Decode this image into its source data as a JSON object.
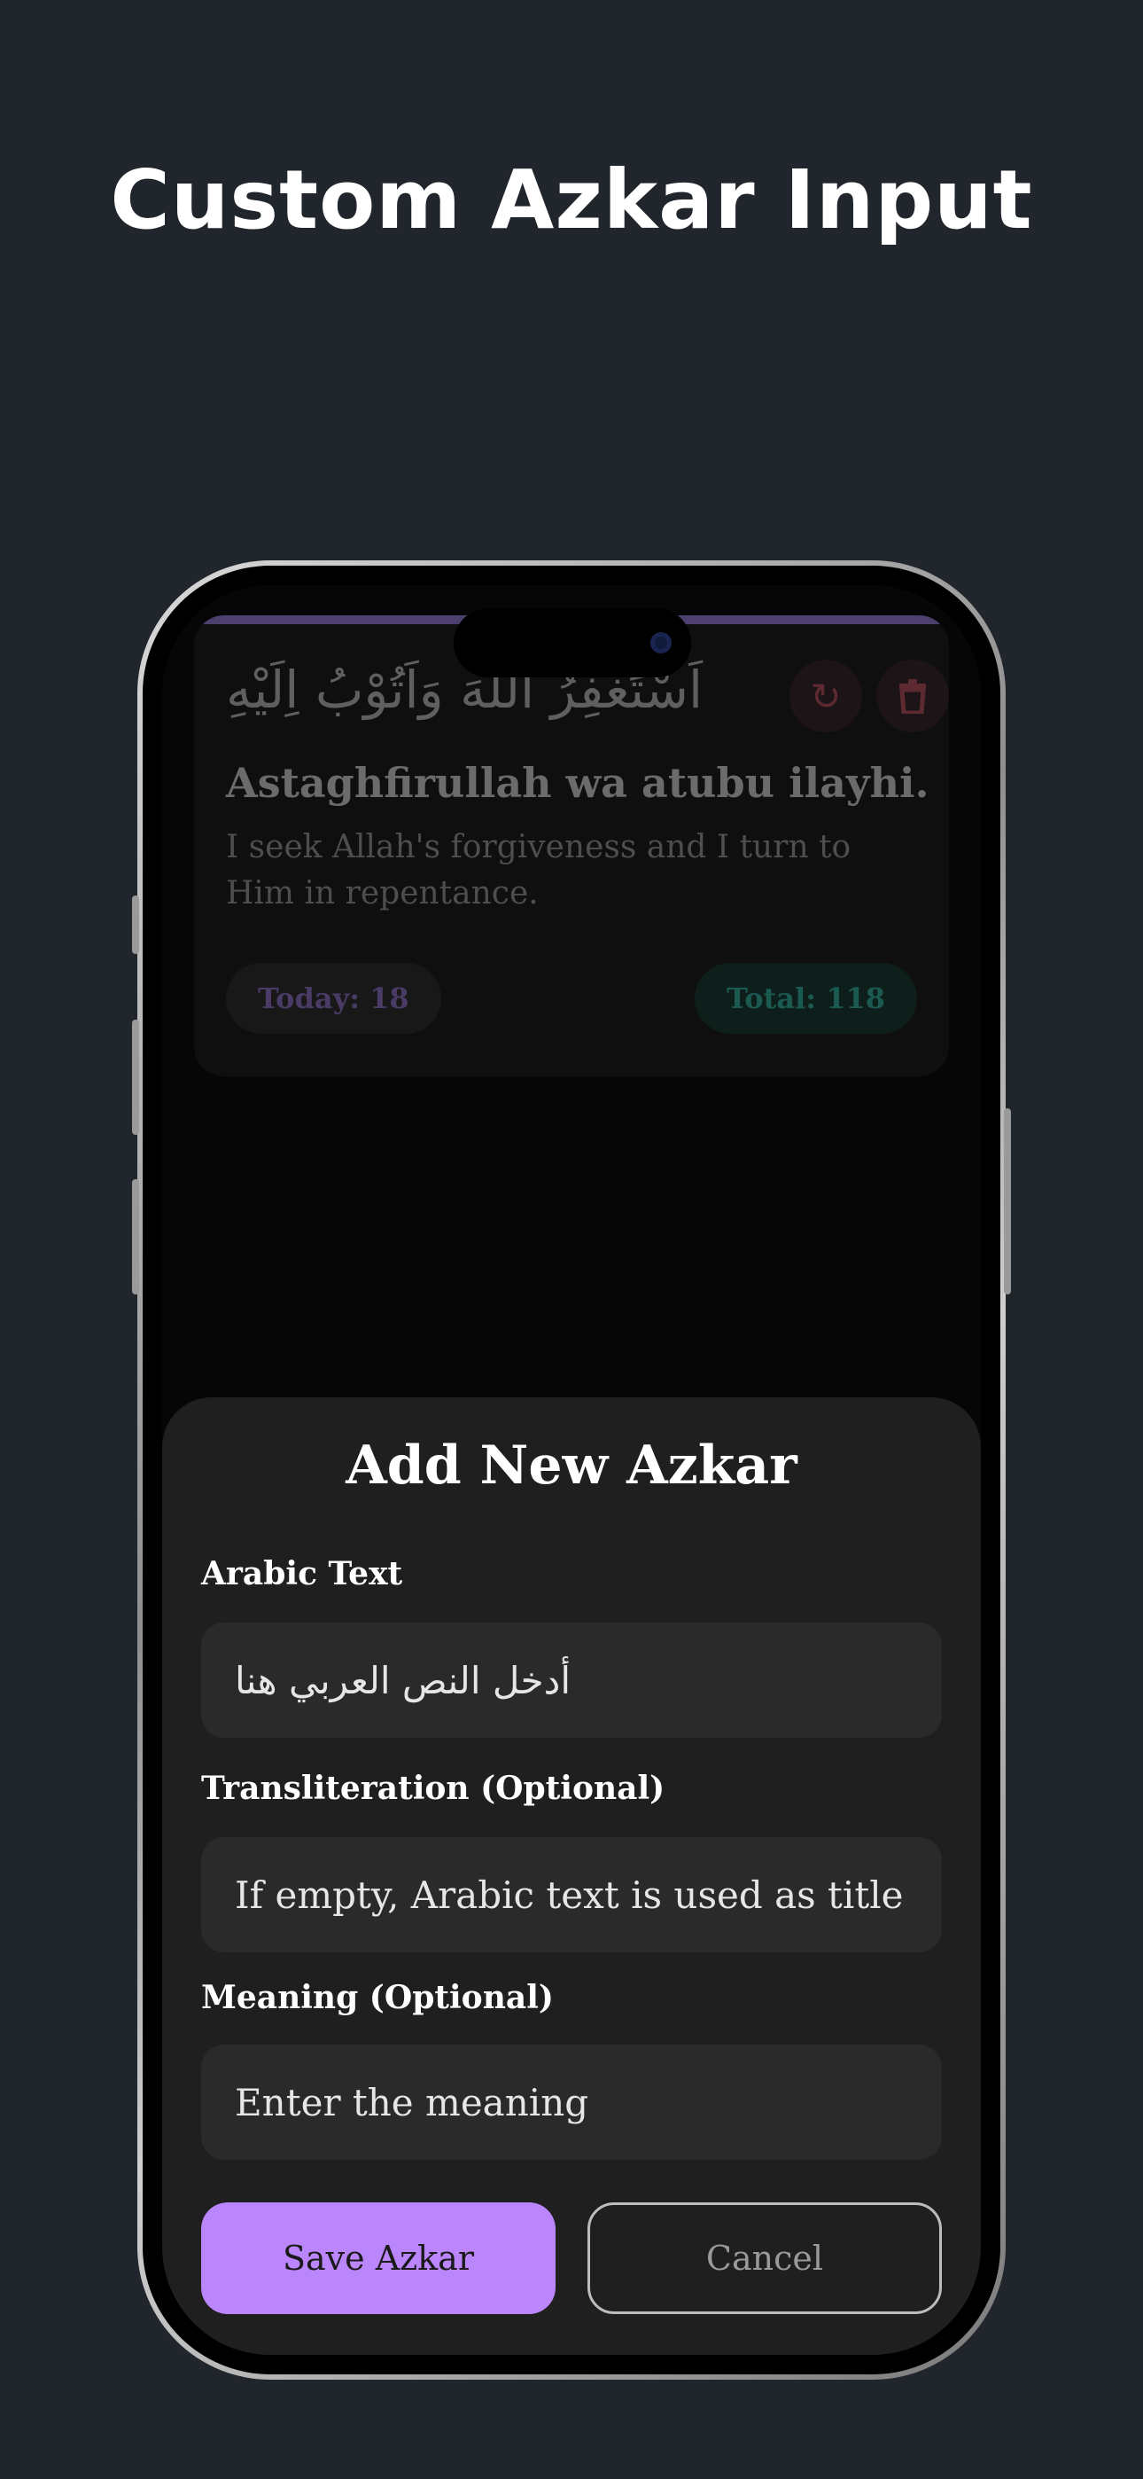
{
  "headline": "Custom Azkar Input",
  "card": {
    "arabic": "اَسْتَغْفِرُ اللّٰهَ وَاَتُوْبُ اِلَيْهِ",
    "transliteration": "Astaghfirullah wa atubu ilayhi.",
    "meaning": "I seek Allah's forgiveness and I turn to Him in repentance.",
    "today": "Today: 18",
    "total": "Total: 118",
    "reset_icon": "refresh-icon",
    "delete_icon": "trash-icon"
  },
  "sheet": {
    "title": "Add New Azkar",
    "arabic_label": "Arabic Text",
    "arabic_placeholder": "أدخل النص العربي هنا",
    "translit_label": "Transliteration (Optional)",
    "translit_placeholder": "If empty, Arabic text is used as title",
    "meaning_label": "Meaning (Optional)",
    "meaning_placeholder": "Enter the meaning",
    "save_label": "Save Azkar",
    "cancel_label": "Cancel"
  },
  "colors": {
    "background": "#21252c",
    "accent": "#bb86fc",
    "sheet": "#1f1f1f"
  }
}
